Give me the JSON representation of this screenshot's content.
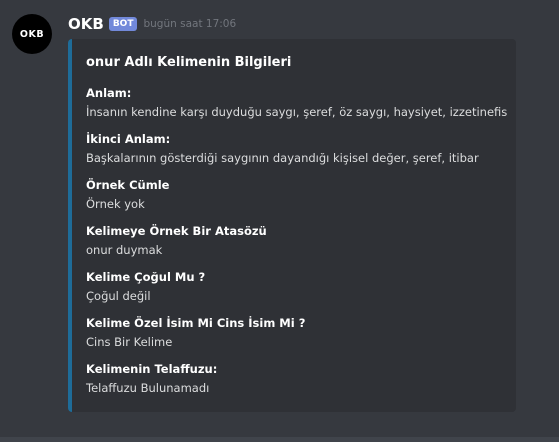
{
  "message": {
    "avatar_text": "OKB",
    "username": "OKB",
    "bot_tag": "BOT",
    "timestamp": "bugün saat 17:06"
  },
  "embed": {
    "accent_color": "#1e6c99",
    "title": "onur Adlı Kelimenin Bilgileri",
    "fields": [
      {
        "name": "Anlam:",
        "value": "İnsanın kendine karşı duyduğu saygı, şeref, öz saygı, haysiyet, izzetinefis"
      },
      {
        "name": "İkinci Anlam:",
        "value": "Başkalarının gösterdiği saygının dayandığı kişisel değer, şeref, itibar"
      },
      {
        "name": "Örnek Cümle",
        "value": "Örnek yok"
      },
      {
        "name": "Kelimeye Örnek Bir Atasözü",
        "value": "onur duymak"
      },
      {
        "name": "Kelime Çoğul Mu ?",
        "value": "Çoğul değil"
      },
      {
        "name": "Kelime Özel İsim Mi Cins İsim Mi ?",
        "value": "Cins Bir Kelime"
      },
      {
        "name": "Kelimenin Telaffuzu:",
        "value": "Telaffuzu Bulunamadı"
      }
    ]
  }
}
